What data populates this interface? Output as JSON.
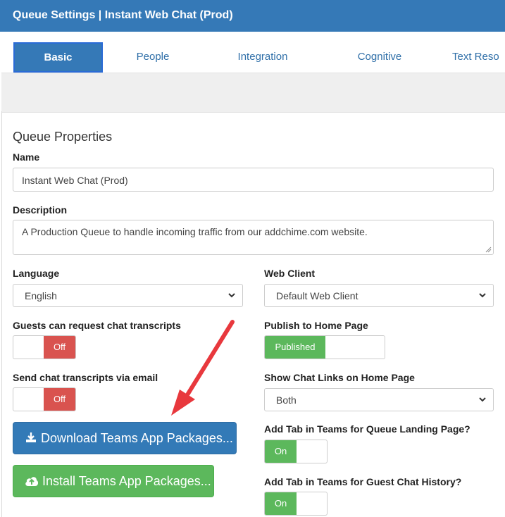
{
  "header": {
    "title": "Queue Settings | Instant Web Chat (Prod)"
  },
  "tabs": [
    {
      "label": "Basic"
    },
    {
      "label": "People"
    },
    {
      "label": "Integration"
    },
    {
      "label": "Cognitive"
    },
    {
      "label": "Text Reso"
    }
  ],
  "section": {
    "title": "Queue Properties"
  },
  "name": {
    "label": "Name",
    "value": "Instant Web Chat (Prod)"
  },
  "description": {
    "label": "Description",
    "value": "A Production Queue to handle incoming traffic from our addchime.com website."
  },
  "language": {
    "label": "Language",
    "value": "English"
  },
  "web_client": {
    "label": "Web Client",
    "value": "Default Web Client"
  },
  "guests_transcripts": {
    "label": "Guests can request chat transcripts",
    "state": "Off"
  },
  "publish_home": {
    "label": "Publish to Home Page",
    "state": "Published"
  },
  "send_transcripts": {
    "label": "Send chat transcripts via email",
    "state": "Off"
  },
  "show_links": {
    "label": "Show Chat Links on Home Page",
    "value": "Both"
  },
  "download_button": {
    "label": "Download Teams App Packages..."
  },
  "install_button": {
    "label": "Install Teams App Packages..."
  },
  "teams_tab_landing": {
    "label": "Add Tab in Teams for Queue Landing Page?",
    "state": "On"
  },
  "teams_tab_history": {
    "label": "Add Tab in Teams for Guest Chat History?",
    "state": "On"
  },
  "colors": {
    "header": "#3579b7",
    "on": "#5cb85c",
    "off": "#d9534f",
    "arrow": "#e8383d"
  },
  "icons": [
    "download-icon",
    "cloud-upload-icon",
    "chevron-down-icon"
  ]
}
